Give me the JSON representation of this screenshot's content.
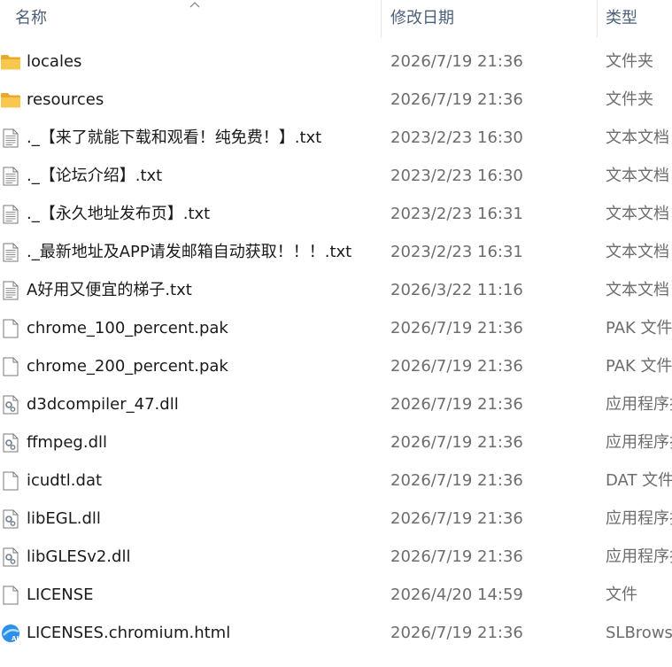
{
  "header": {
    "name_label": "名称",
    "date_label": "修改日期",
    "type_label": "类型"
  },
  "colors": {
    "folder": "#f4c149",
    "header_text": "#4c607a",
    "secondary_text": "#6d6d6d"
  },
  "files": [
    {
      "name": "locales",
      "date": "2026/7/19 21:36",
      "type": "文件夹",
      "icon": "folder-icon"
    },
    {
      "name": "resources",
      "date": "2026/7/19 21:36",
      "type": "文件夹",
      "icon": "folder-icon"
    },
    {
      "name": "._【来了就能下载和观看！纯免费！】.txt",
      "date": "2023/2/23 16:30",
      "type": "文本文档",
      "icon": "text-file-icon"
    },
    {
      "name": "._【论坛介绍】.txt",
      "date": "2023/2/23 16:30",
      "type": "文本文档",
      "icon": "text-file-icon"
    },
    {
      "name": "._【永久地址发布页】.txt",
      "date": "2023/2/23 16:31",
      "type": "文本文档",
      "icon": "text-file-icon"
    },
    {
      "name": "._最新地址及APP请发邮箱自动获取！！！.txt",
      "date": "2023/2/23 16:31",
      "type": "文本文档",
      "icon": "text-file-icon"
    },
    {
      "name": "A好用又便宜的梯子.txt",
      "date": "2026/3/22 11:16",
      "type": "文本文档",
      "icon": "text-file-icon"
    },
    {
      "name": "chrome_100_percent.pak",
      "date": "2026/7/19 21:36",
      "type": "PAK 文件",
      "icon": "blank-file-icon"
    },
    {
      "name": "chrome_200_percent.pak",
      "date": "2026/7/19 21:36",
      "type": "PAK 文件",
      "icon": "blank-file-icon"
    },
    {
      "name": "d3dcompiler_47.dll",
      "date": "2026/7/19 21:36",
      "type": "应用程序扩展",
      "icon": "dll-file-icon"
    },
    {
      "name": "ffmpeg.dll",
      "date": "2026/7/19 21:36",
      "type": "应用程序扩展",
      "icon": "dll-file-icon"
    },
    {
      "name": "icudtl.dat",
      "date": "2026/7/19 21:36",
      "type": "DAT 文件",
      "icon": "blank-file-icon"
    },
    {
      "name": "libEGL.dll",
      "date": "2026/7/19 21:36",
      "type": "应用程序扩展",
      "icon": "dll-file-icon"
    },
    {
      "name": "libGLESv2.dll",
      "date": "2026/7/19 21:36",
      "type": "应用程序扩展",
      "icon": "dll-file-icon"
    },
    {
      "name": "LICENSE",
      "date": "2026/4/20 14:59",
      "type": "文件",
      "icon": "blank-file-icon"
    },
    {
      "name": "LICENSES.chromium.html",
      "date": "2026/7/19 21:36",
      "type": "SLBrowser",
      "icon": "browser-html-icon"
    }
  ]
}
